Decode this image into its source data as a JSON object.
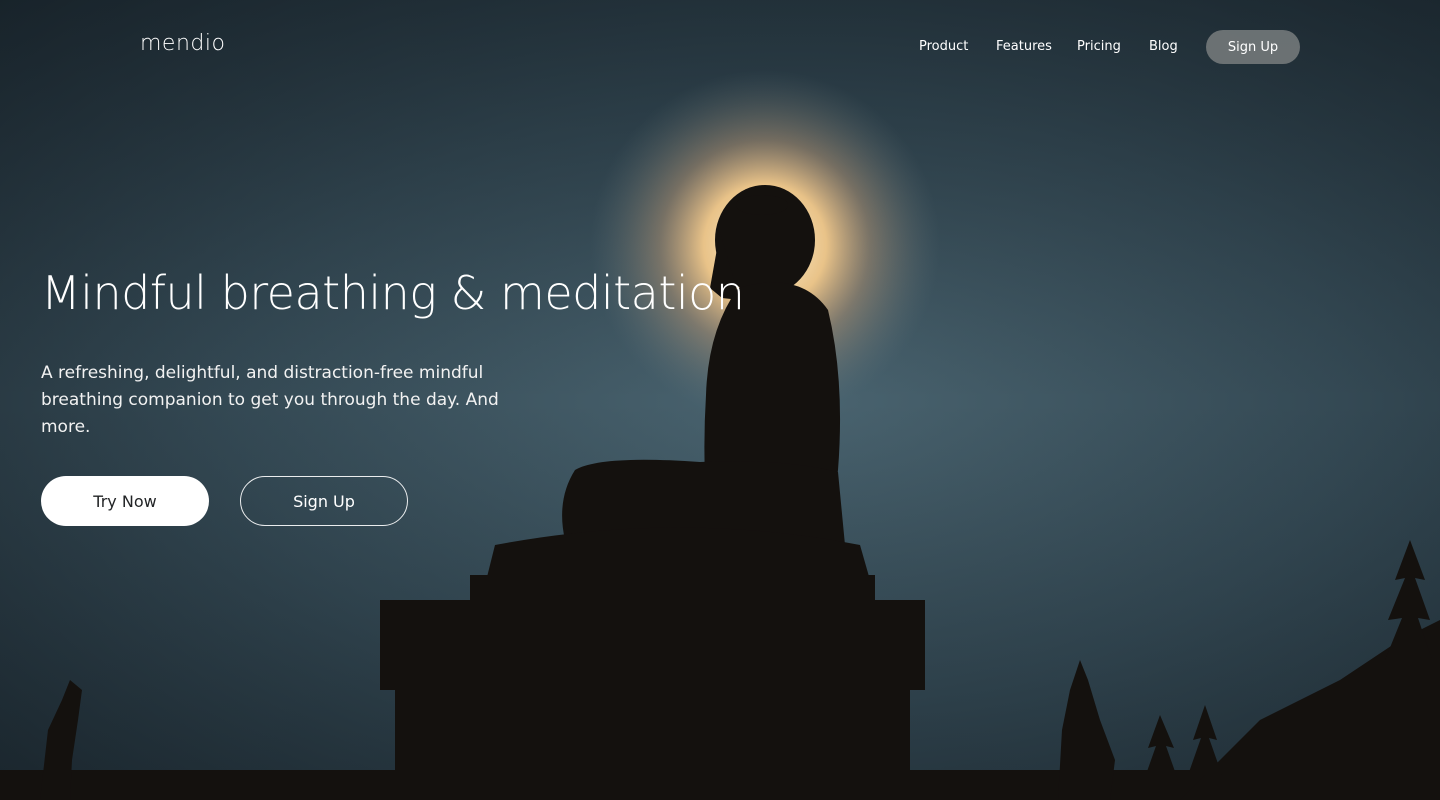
{
  "brand": {
    "name": "mendio"
  },
  "nav": {
    "links": [
      {
        "label": "Product"
      },
      {
        "label": "Features"
      },
      {
        "label": "Pricing"
      },
      {
        "label": "Blog"
      }
    ],
    "signup_label": "Sign Up"
  },
  "hero": {
    "title": "Mindful breathing & meditation",
    "subtitle": "A refreshing, delightful, and distraction-free mindful breathing companion to get you through the day. And more.",
    "primary_cta": "Try Now",
    "secondary_cta": "Sign Up",
    "image": "buddha-statue-silhouette-with-halo"
  },
  "colors": {
    "sky_top": "#1e2a33",
    "sky_mid": "#3e5661",
    "halo": "#f3c98a",
    "silhouette": "#15120f",
    "nav_button": "#787c7e",
    "primary_button": "#ffffff"
  }
}
